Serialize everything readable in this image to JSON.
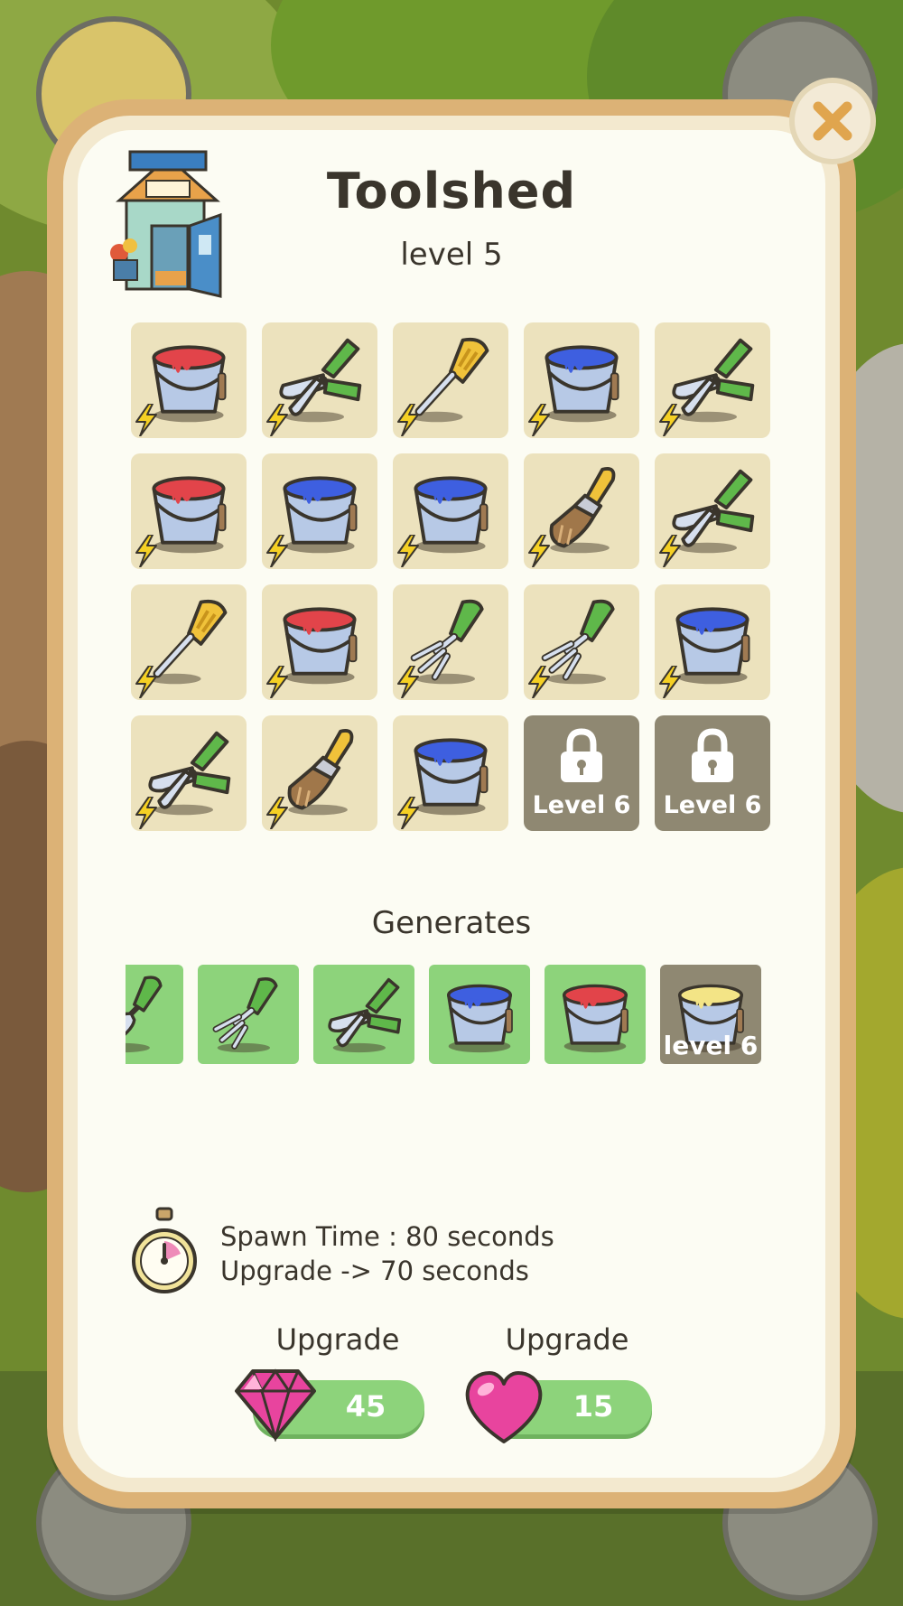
{
  "building": {
    "title": "Toolshed",
    "level": "level 5"
  },
  "grid": {
    "rows": [
      [
        {
          "item": "red-paint-bucket-icon",
          "energy": true
        },
        {
          "item": "pruning-shears-icon",
          "energy": true
        },
        {
          "item": "screwdriver-icon",
          "energy": true
        },
        {
          "item": "blue-paint-bucket-icon",
          "energy": true
        },
        {
          "item": "pruning-shears-icon",
          "energy": true
        }
      ],
      [
        {
          "item": "red-paint-bucket-icon",
          "energy": true
        },
        {
          "item": "blue-paint-bucket-icon",
          "energy": true
        },
        {
          "item": "blue-paint-bucket-icon",
          "energy": true
        },
        {
          "item": "paintbrush-icon",
          "energy": true
        },
        {
          "item": "pruning-shears-icon",
          "energy": true
        }
      ],
      [
        {
          "item": "screwdriver-icon",
          "energy": true
        },
        {
          "item": "red-paint-bucket-icon",
          "energy": true
        },
        {
          "item": "garden-fork-icon",
          "energy": true
        },
        {
          "item": "garden-fork-icon",
          "energy": true
        },
        {
          "item": "blue-paint-bucket-icon",
          "energy": true
        }
      ],
      [
        {
          "item": "pruning-shears-icon",
          "energy": true
        },
        {
          "item": "paintbrush-icon",
          "energy": true
        },
        {
          "item": "blue-paint-bucket-icon",
          "energy": true
        },
        {
          "item": "lock-icon",
          "locked": true,
          "label": "Level 6"
        },
        {
          "item": "lock-icon",
          "locked": true,
          "label": "Level 6"
        }
      ]
    ]
  },
  "generates": {
    "title": "Generates",
    "items": [
      {
        "item": "garden-trowel-icon"
      },
      {
        "item": "garden-fork-icon"
      },
      {
        "item": "pruning-shears-icon"
      },
      {
        "item": "blue-paint-bucket-icon"
      },
      {
        "item": "red-paint-bucket-icon"
      },
      {
        "item": "yellow-paint-bucket-icon",
        "locked": true,
        "label": "level 6"
      }
    ]
  },
  "spawn": {
    "time": "Spawn Time : 80 seconds",
    "upgrade": "Upgrade -> 70 seconds"
  },
  "upgrades": {
    "gem": {
      "label": "Upgrade",
      "cost": "45",
      "icon": "gem-icon"
    },
    "heart": {
      "label": "Upgrade",
      "cost": "15",
      "icon": "heart-icon"
    }
  },
  "colors": {
    "tile": "#ece2bd",
    "locked_tile": "#8f8872",
    "generate_tile": "#8dd37b",
    "modal_border": "#dcb276",
    "gem": "#e8449e",
    "heart": "#e8449e"
  }
}
